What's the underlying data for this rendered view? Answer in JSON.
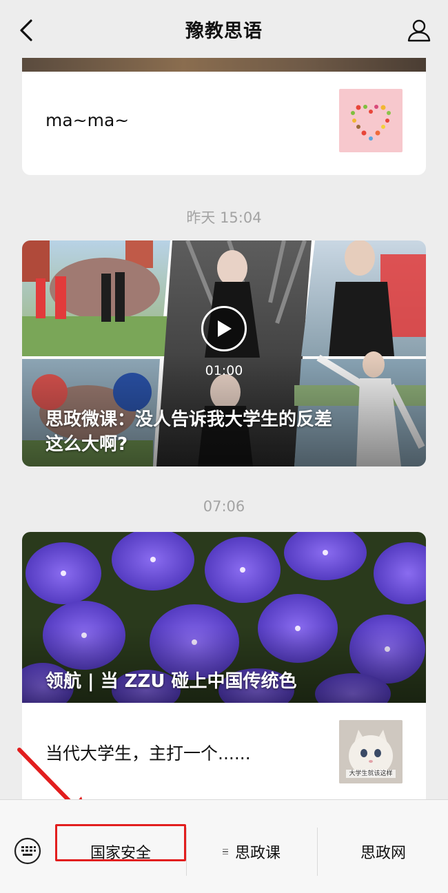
{
  "header": {
    "title": "豫教思语"
  },
  "feed": [
    {
      "type": "text-card",
      "text": "ma~ma~"
    },
    {
      "type": "timestamp",
      "text": "昨天 15:04"
    },
    {
      "type": "video-card",
      "duration": "01:00",
      "title_line1": "思政微课：没人告诉我大学生的反差",
      "title_line2": "这么大啊?"
    },
    {
      "type": "timestamp",
      "text": "07:06"
    },
    {
      "type": "article-card",
      "hero_title": "领航 | 当 ZZU 碰上中国传统色",
      "sub_text": "当代大学生，主打一个......",
      "thumb_caption": "大学生就该这样"
    }
  ],
  "bottom_menu": {
    "items": [
      {
        "label": "国家安全"
      },
      {
        "label": "思政课"
      },
      {
        "label": "思政网"
      }
    ]
  },
  "colors": {
    "accent": "#e21e1e",
    "background": "#ededed"
  }
}
